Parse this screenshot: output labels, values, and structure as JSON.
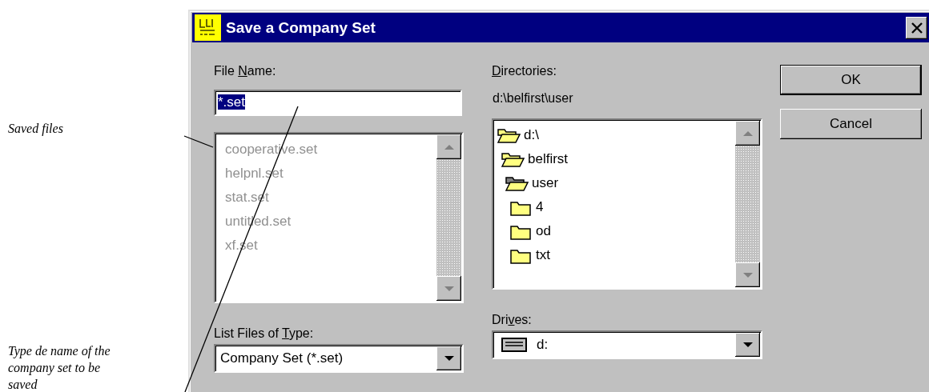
{
  "annotations": [
    {
      "text": "Saved files"
    },
    {
      "text": "Type de name of the company set to be saved"
    }
  ],
  "window": {
    "title": "Save a Company Set"
  },
  "file_name": {
    "label": {
      "key": "N",
      "before": "File ",
      "after": "ame:"
    },
    "value": "*.set",
    "highlighted": true
  },
  "files": {
    "dimmed": true,
    "items": [
      {
        "name": "cooperative.set"
      },
      {
        "name": "helpnl.set"
      },
      {
        "name": "stat.set"
      },
      {
        "name": "untitled.set"
      },
      {
        "name": "xf.set"
      }
    ]
  },
  "directories": {
    "label": {
      "key": "D",
      "after": "irectories:"
    },
    "path": "d:\\belfirst\\user",
    "tree": [
      {
        "name": "d:\\",
        "expanded": true,
        "selected": false,
        "children": [
          {
            "name": "belfirst",
            "expanded": true,
            "selected": false,
            "children": [
              {
                "name": "user",
                "expanded": true,
                "selected": true,
                "children": [
                  {
                    "name": "4",
                    "expanded": false,
                    "selected": false
                  },
                  {
                    "name": "od",
                    "expanded": false,
                    "selected": false
                  },
                  {
                    "name": "txt",
                    "expanded": false,
                    "selected": false
                  }
                ]
              }
            ]
          }
        ]
      }
    ]
  },
  "file_type": {
    "label": {
      "key": "T",
      "before": "List Files of ",
      "after": "ype:"
    },
    "value": "Company Set (*.set)"
  },
  "drives": {
    "label": {
      "key": "v",
      "before": "Dri",
      "after": "es:"
    },
    "value": "d:"
  },
  "buttons": [
    {
      "label": "OK",
      "default": true
    },
    {
      "label": "Cancel",
      "default": false
    }
  ]
}
